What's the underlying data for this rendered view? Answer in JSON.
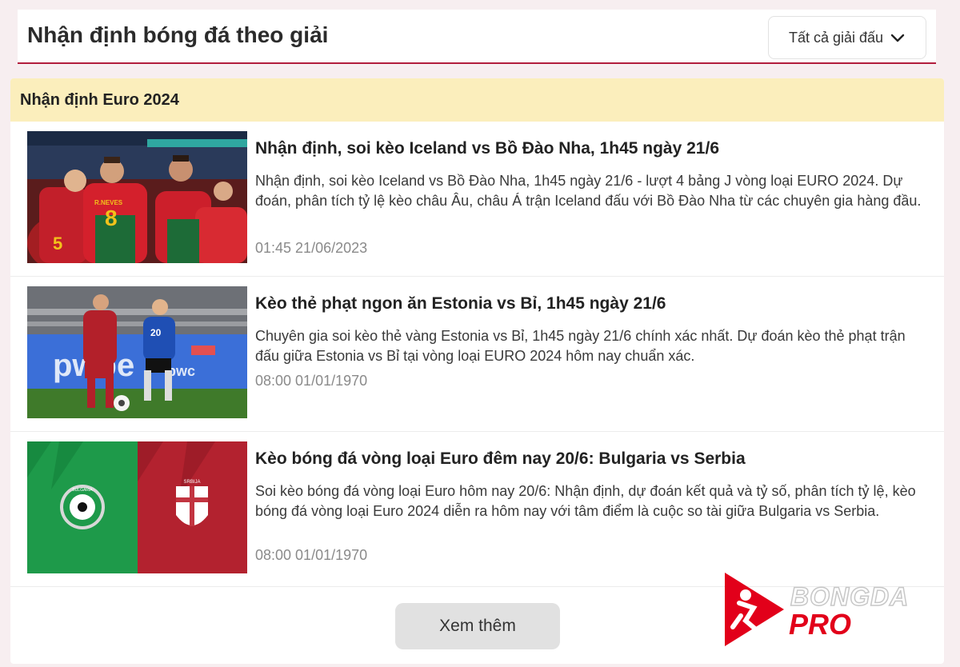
{
  "header": {
    "title": "Nhận định bóng đá theo giải",
    "league_select": {
      "selected": "Tất cả giải đấu",
      "icon": "chevron-down-icon"
    }
  },
  "section": {
    "title": "Nhận định Euro 2024",
    "header_color": "#fbeebc",
    "accent_color": "#b21d3c",
    "articles": [
      {
        "title": "Nhận định, soi kèo Iceland vs Bồ Đào Nha, 1h45 ngày 21/6",
        "description": "Nhận định, soi kèo Iceland vs Bồ Đào Nha, 1h45 ngày 21/6 - lượt 4 bảng J vòng loại EURO 2024. Dự đoán, phân tích tỷ lệ kèo châu Âu, châu Á trận Iceland đấu với Bồ Đào Nha từ các chuyên gia hàng đầu.",
        "date": "01:45 21/06/2023",
        "thumb": {
          "shirt_text": "R.NEVES"
        }
      },
      {
        "title": "Kèo thẻ phạt ngon ăn Estonia vs Bỉ, 1h45 ngày 21/6",
        "description": "Chuyên gia soi kèo thẻ vàng Estonia vs Bỉ, 1h45 ngày 21/6 chính xác nhất. Dự đoán kèo thẻ phạt trận đấu giữa Estonia vs Bỉ tại vòng loại EURO 2024 hôm nay chuẩn xác.",
        "date": "08:00 01/01/1970",
        "thumb": {
          "board_text": "pwbe",
          "board_text_2": "pwc"
        }
      },
      {
        "title": "Kèo bóng đá vòng loại Euro đêm nay 20/6: Bulgaria vs Serbia",
        "description": "Soi kèo bóng đá vòng loại Euro hôm nay 20/6: Nhận định, dự đoán kết quả và tỷ số, phân tích tỷ lệ, kèo bóng đá vòng loại Euro 2024 diễn ra hôm nay với tâm điểm là cuộc so tài giữa Bulgaria vs Serbia.",
        "date": "08:00 01/01/1970",
        "thumb": {
          "left_color": "#1e9a4a",
          "right_color": "#b3222f",
          "left_crest_text": "BULGARIA",
          "right_crest_text": "SRBIJA"
        }
      }
    ]
  },
  "more_button": {
    "label": "Xem thêm"
  },
  "logo": {
    "word1": "BONGDA",
    "word2": "PRO",
    "color": "#e2001a"
  }
}
